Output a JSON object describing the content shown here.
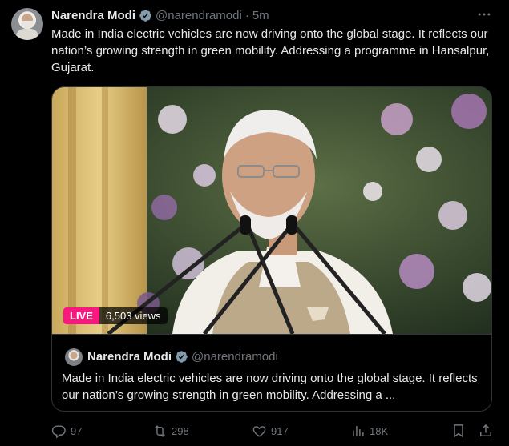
{
  "tweet": {
    "author_name": "Narendra Modi",
    "author_handle": "@narendramodi",
    "separator": "·",
    "time": "5m",
    "text": "Made in India electric vehicles are now driving onto the global stage. It reflects our nation’s growing strength in green mobility. Addressing a programme in Hansalpur, Gujarat."
  },
  "media": {
    "live_label": "LIVE",
    "views": "6,503 views"
  },
  "quote": {
    "author_name": "Narendra Modi",
    "author_handle": "@narendramodi",
    "text": "Made in India electric vehicles are now driving onto the global stage. It reflects our nation’s growing strength in green mobility. Addressing a ..."
  },
  "actions": {
    "replies": "97",
    "reposts": "298",
    "likes": "917",
    "views": "18K"
  },
  "icons": [
    "more-icon",
    "verified-icon",
    "reply-icon",
    "repost-icon",
    "like-icon",
    "views-icon",
    "bookmark-icon",
    "share-icon"
  ],
  "colors": {
    "background": "#000000",
    "text": "#e7e9ea",
    "muted": "#71767b",
    "verified": "#829aab",
    "live": "#f91880",
    "border": "#2f3336"
  }
}
